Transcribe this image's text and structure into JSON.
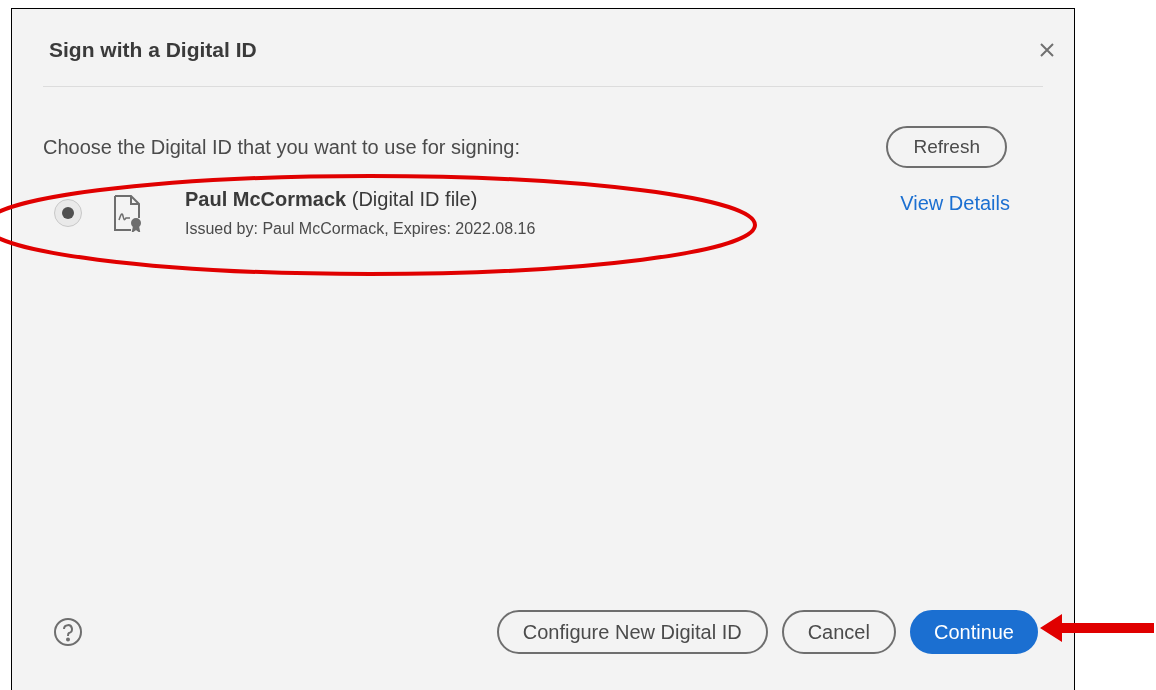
{
  "dialog": {
    "title": "Sign with a Digital ID",
    "prompt": "Choose the Digital ID that you want to use for signing:",
    "refresh_button": "Refresh",
    "ids": [
      {
        "name": "**Paul McCormack** (Digital ID file)",
        "issued": "Issued by: Paul McCormack, Expires: 2022.08.16",
        "selected": true,
        "link": "View Details"
      }
    ],
    "buttons": [
      {
        "label": "Configure New Digital ID",
        "kind": "secondary"
      },
      {
        "label": "Cancel",
        "kind": "secondary"
      },
      {
        "label": "Continue",
        "kind": "primary"
      }
    ]
  }
}
